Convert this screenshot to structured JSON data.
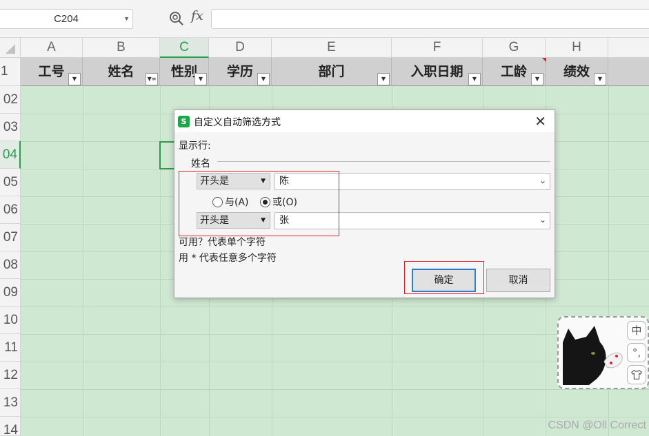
{
  "formula_bar": {
    "name_box": "C204",
    "fx_label": "fx",
    "formula_value": ""
  },
  "columns": [
    "A",
    "B",
    "C",
    "D",
    "E",
    "F",
    "G",
    "H"
  ],
  "header_row": {
    "row_number": "1",
    "cells": [
      "工号",
      "姓名",
      "性别",
      "学历",
      "部门",
      "入职日期",
      "工龄",
      "绩效"
    ]
  },
  "row_numbers": [
    "02",
    "03",
    "04",
    "05",
    "06",
    "07",
    "08",
    "09",
    "10",
    "11",
    "12",
    "13",
    "14"
  ],
  "dialog": {
    "title": "自定义自动筛选方式",
    "show_rows_label": "显示行:",
    "field_label": "姓名",
    "condition1": {
      "operator": "开头是",
      "value": "陈"
    },
    "and_label": "与(A)",
    "or_label": "或(O)",
    "or_selected": true,
    "condition2": {
      "operator": "开头是",
      "value": "张"
    },
    "hint1": "可用？代表单个字符",
    "hint2": "用 * 代表任意多个字符",
    "ok_label": "确定",
    "cancel_label": "取消"
  },
  "ime": {
    "btn1": "中",
    "btn2": "°,",
    "btn3": "shirt-icon"
  },
  "watermark": "CSDN @Oll Correct"
}
